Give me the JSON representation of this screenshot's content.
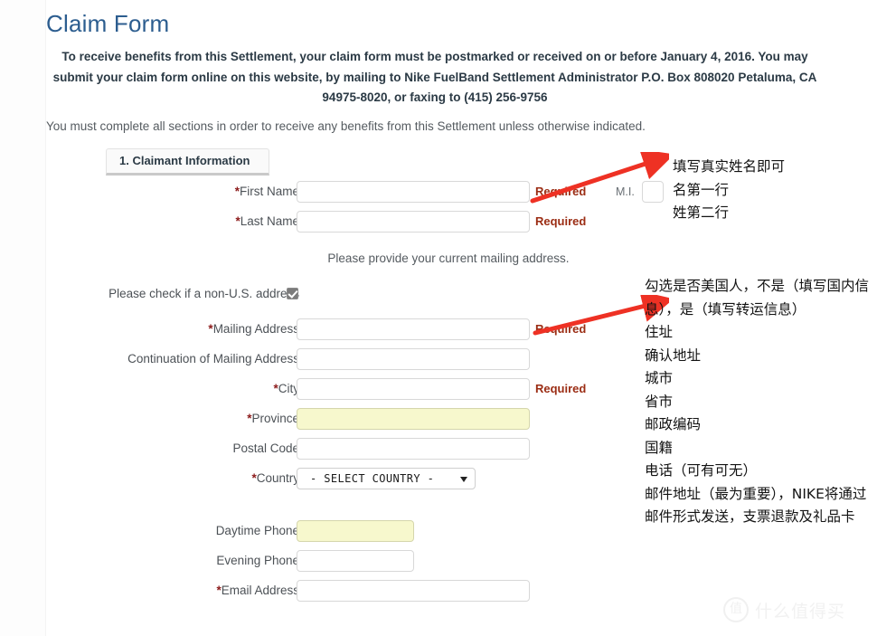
{
  "page": {
    "title": "Claim Form",
    "notice": "To receive benefits from this Settlement, your claim form must be postmarked or received on or before January 4, 2016. You may submit your claim form online on this website, by mailing to Nike FuelBand Settlement Administrator P.O. Box 808020 Petaluma, CA 94975-8020, or faxing to (415) 256-9756",
    "instruction": "You must complete all sections in order to receive any benefits from this Settlement unless otherwise indicated.",
    "title_color": "#2c5d8f",
    "required_color": "#9b2d14",
    "asterisk_color": "#8c1b1b",
    "autofill_color": "#f7f8cd"
  },
  "tabs": [
    {
      "label": "1. Claimant Information",
      "active": true
    }
  ],
  "form": {
    "required_text": "Required",
    "mailing_note": "Please provide your current mailing address.",
    "non_us_label": "Please check if a non-U.S. address",
    "non_us_checked": true,
    "middle_initial": {
      "label": "M.I.",
      "value": ""
    },
    "fields": [
      {
        "label": "First Name",
        "required": true,
        "value": "",
        "style": "normal",
        "show_required_flag": true
      },
      {
        "label": "Last Name",
        "required": true,
        "value": "",
        "style": "normal",
        "show_required_flag": true
      },
      {
        "label": "Mailing Address",
        "required": true,
        "value": "",
        "style": "normal",
        "show_required_flag": true
      },
      {
        "label": "Continuation of Mailing Address",
        "required": false,
        "value": "",
        "style": "normal",
        "show_required_flag": false
      },
      {
        "label": "City",
        "required": true,
        "value": "",
        "style": "normal",
        "show_required_flag": true
      },
      {
        "label": "Province",
        "required": true,
        "value": "",
        "style": "autofill",
        "show_required_flag": false
      },
      {
        "label": "Postal Code",
        "required": false,
        "value": "",
        "style": "normal",
        "show_required_flag": false
      },
      {
        "label": "Country",
        "required": true,
        "value": "- SELECT COUNTRY -",
        "style": "select",
        "show_required_flag": false
      },
      {
        "label": "Daytime Phone",
        "required": false,
        "value": "",
        "style": "autofill-short",
        "show_required_flag": false
      },
      {
        "label": "Evening Phone",
        "required": false,
        "value": "",
        "style": "short",
        "show_required_flag": false
      },
      {
        "label": "Email Address",
        "required": true,
        "value": "",
        "style": "normal",
        "show_required_flag": false
      }
    ],
    "country_select": {
      "selected": "- SELECT COUNTRY -",
      "options": [
        "- SELECT COUNTRY -"
      ]
    }
  },
  "annotations": {
    "name_note": "填写真实姓名即可\n名第一行\n姓第二行",
    "address_note": "勾选是否美国人，不是（填写国内信息），是（填写转运信息）\n住址\n确认地址\n城市\n省市\n邮政编码\n国籍\n电话（可有可无）\n邮件地址（最为重要），NIKE将通过邮件形式发送，支票退款及礼品卡",
    "arrow_color": "#ee3124"
  },
  "watermark": {
    "badge": "值",
    "text": "什么值得买"
  }
}
